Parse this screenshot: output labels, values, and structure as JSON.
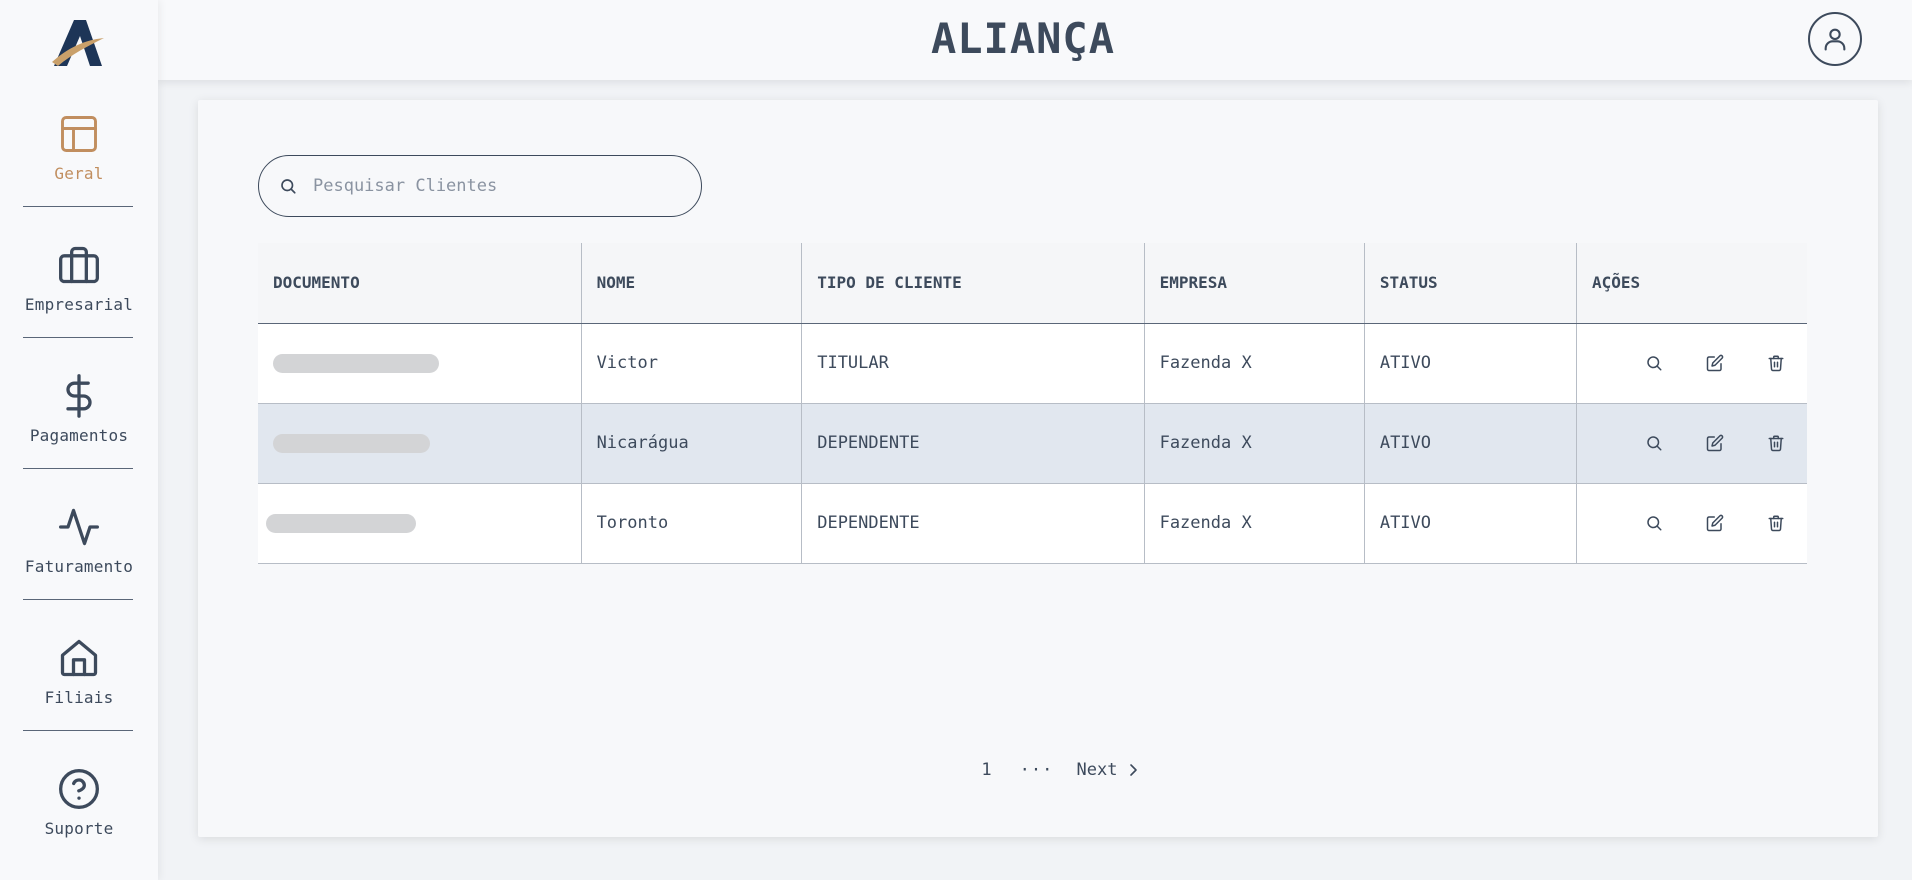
{
  "app": {
    "title": "ALIANÇA"
  },
  "sidebar": {
    "items": [
      {
        "label": "Geral",
        "icon": "layout-icon",
        "active": true
      },
      {
        "label": "Empresarial",
        "icon": "briefcase-icon",
        "active": false
      },
      {
        "label": "Pagamentos",
        "icon": "dollar-icon",
        "active": false
      },
      {
        "label": "Faturamento",
        "icon": "activity-icon",
        "active": false
      },
      {
        "label": "Filiais",
        "icon": "home-icon",
        "active": false
      },
      {
        "label": "Suporte",
        "icon": "help-circle-icon",
        "active": false
      }
    ]
  },
  "search": {
    "placeholder": "Pesquisar Clientes",
    "value": ""
  },
  "table": {
    "columns": [
      "DOCUMENTO",
      "NOME",
      "TIPO DE CLIENTE",
      "EMPRESA",
      "STATUS",
      "AÇÕES"
    ],
    "rows": [
      {
        "nome": "Victor",
        "tipo": "TITULAR",
        "empresa": "Fazenda X",
        "status": "ATIVO"
      },
      {
        "nome": "Nicarágua",
        "tipo": "DEPENDENTE",
        "empresa": "Fazenda X",
        "status": "ATIVO"
      },
      {
        "nome": "Toronto",
        "tipo": "DEPENDENTE",
        "empresa": "Fazenda X",
        "status": "ATIVO"
      }
    ]
  },
  "pagination": {
    "current_page": "1",
    "ellipsis": "···",
    "next_label": "Next"
  },
  "colors": {
    "accent": "#c18e5f",
    "text": "#3d4a5c",
    "row_highlight": "#e1e7ef",
    "logo_navy": "#1d3557"
  }
}
